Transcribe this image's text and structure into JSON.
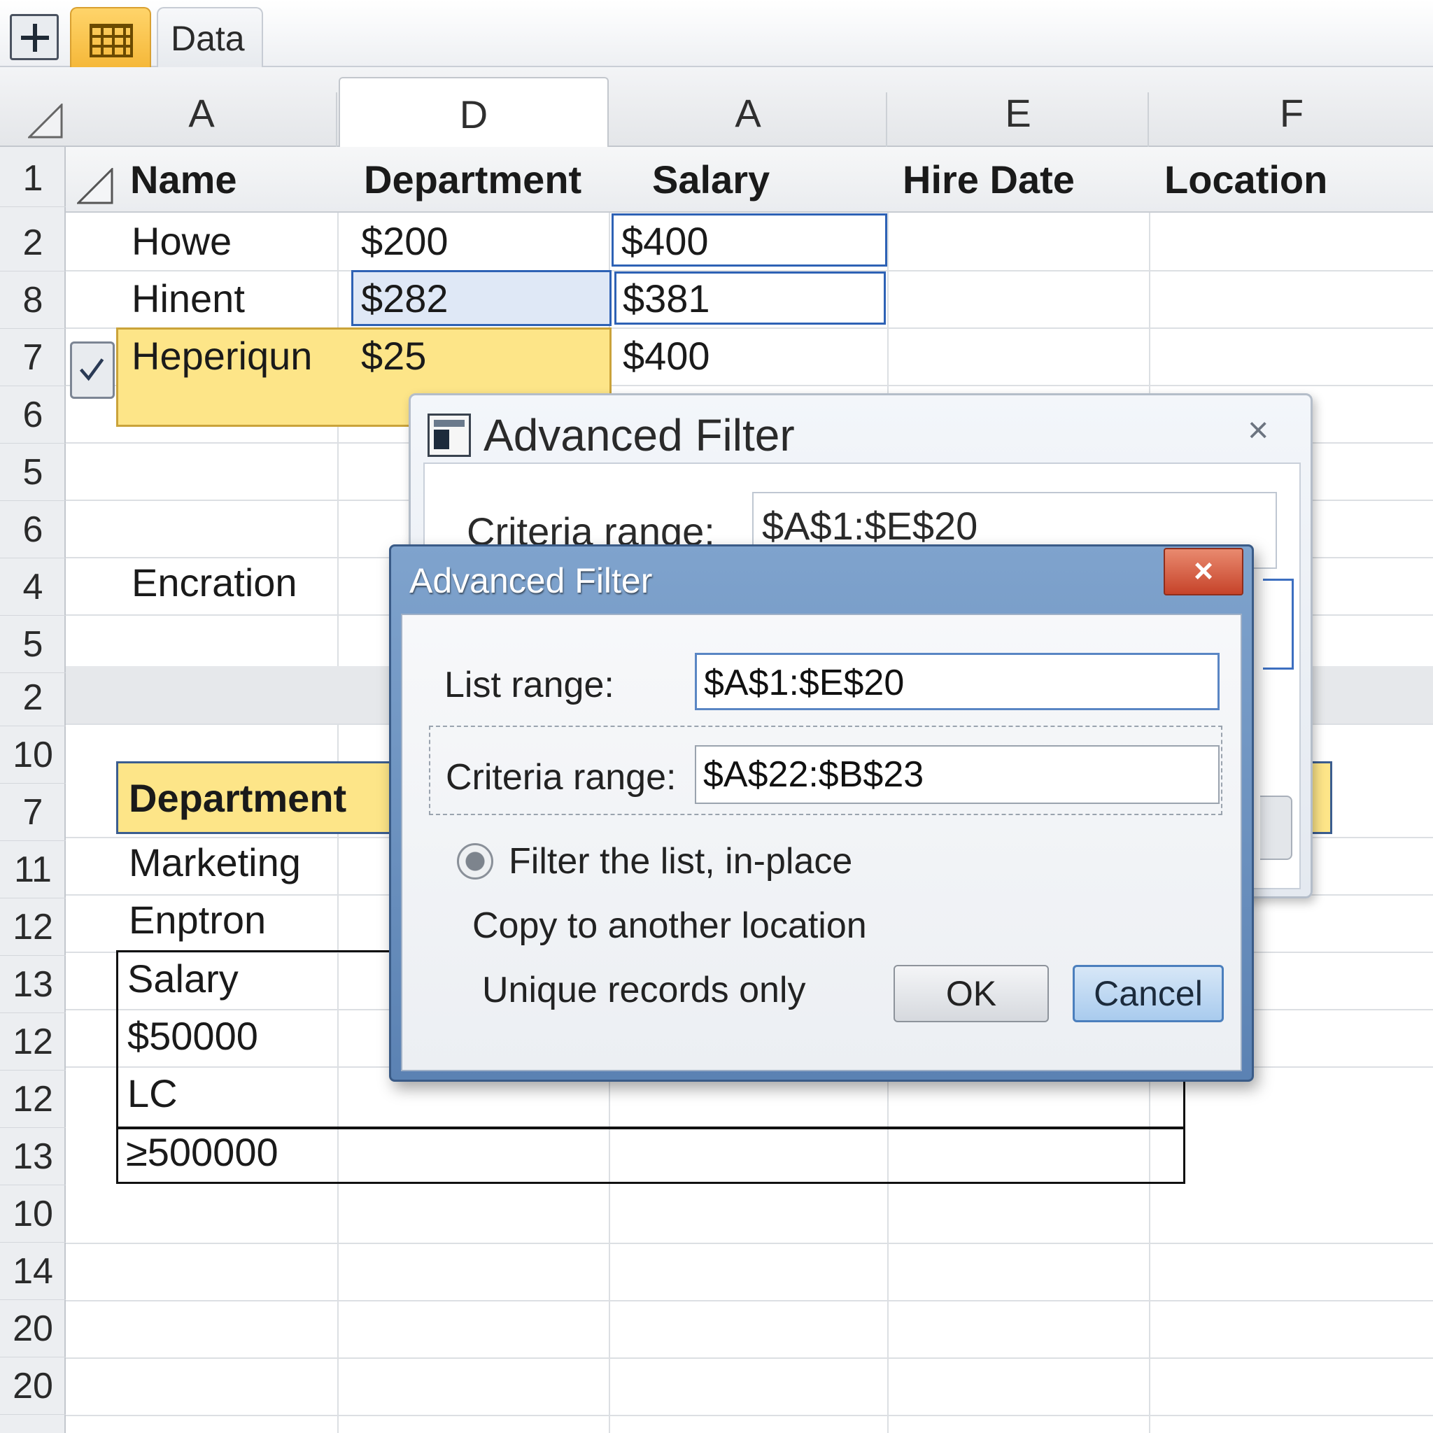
{
  "tabstrip": {
    "add_icon": "plus-icon",
    "grid_icon": "table-grid-icon",
    "tab_label": "Data"
  },
  "columns": [
    "A",
    "D",
    "A",
    "E",
    "F"
  ],
  "row_numbers": [
    "1",
    "2",
    "8",
    "7",
    "6",
    "5",
    "6",
    "4",
    "5",
    "2",
    "10",
    "7",
    "11",
    "12",
    "13",
    "12",
    "12",
    "13",
    "10",
    "14",
    "20",
    "20"
  ],
  "table": {
    "headers": [
      "Name",
      "Department",
      "Salary",
      "Hire Date",
      "Location"
    ],
    "rows": [
      {
        "name": "Howe",
        "dept": "$200",
        "salary": "$400"
      },
      {
        "name": "Hinent",
        "dept": "$282",
        "salary": "$381"
      },
      {
        "name": "Heperiqun",
        "dept": "$25",
        "salary": "$400"
      }
    ]
  },
  "extra_cell": "Encration",
  "criteria": {
    "header": "Department",
    "values": [
      "Marketing",
      "Enptron",
      "Salary",
      "$50000",
      "LC",
      "≥500000"
    ]
  },
  "dialog_back": {
    "title": "Advanced Filter",
    "close_glyph": "×",
    "criteria_label": "Criteria range:",
    "criteria_value": "$A$1:$E$20"
  },
  "dialog": {
    "title": "Advanced Filter",
    "close_glyph": "×",
    "list_label": "List range:",
    "list_value": "$A$1:$E$20",
    "criteria_label": "Criteria range:",
    "criteria_value": "$A$22:$B$23",
    "radio_label": "Filter the list, in-place",
    "copy_label": "Copy to another location",
    "unique_label": "Unique records only",
    "ok_label": "OK",
    "cancel_label": "Cancel"
  },
  "colors": {
    "accent_yellow": "#fde588",
    "selection_blue": "#2e62b5",
    "dialog_title_blue": "#5b82b3",
    "close_red": "#c6432a"
  }
}
